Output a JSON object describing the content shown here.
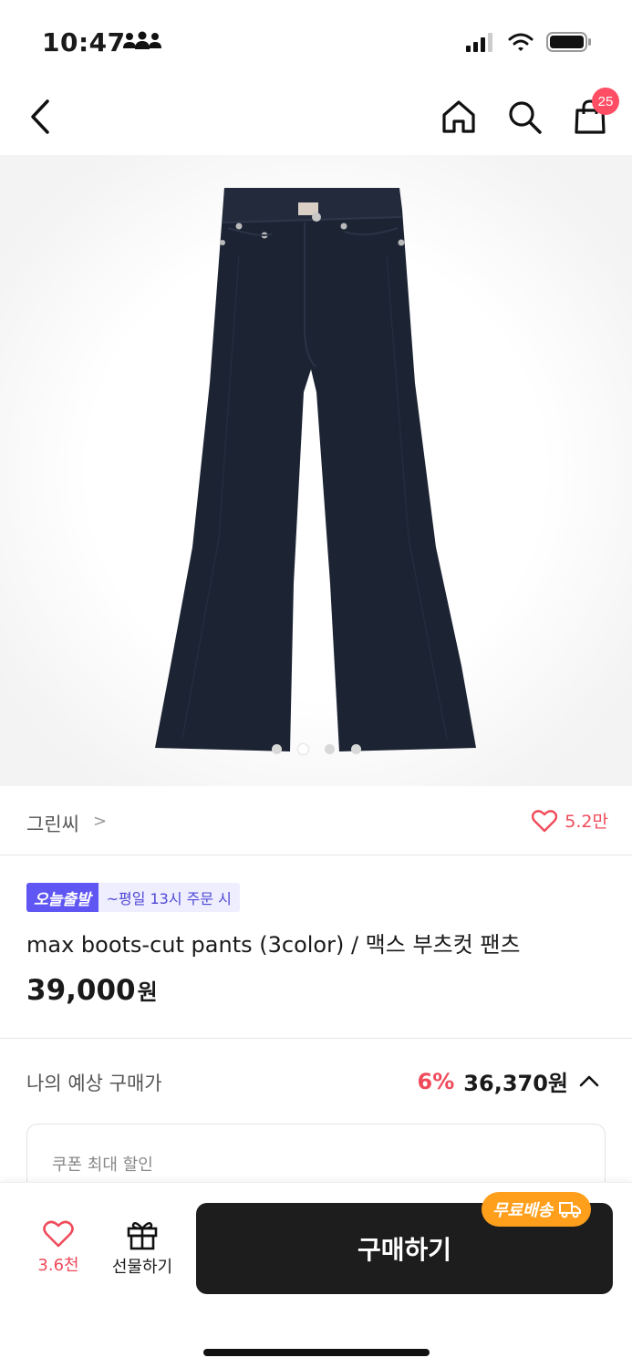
{
  "status": {
    "time": "10:47"
  },
  "nav": {
    "cart_count": "25"
  },
  "product": {
    "brand": "그린씨",
    "brand_chevron": ">",
    "likes": "5.2만",
    "tag_today": "오늘출발",
    "tag_desc": "~평일 13시 주문 시",
    "title": "max boots-cut pants (3color) / 맥스 부츠컷 팬츠",
    "price": "39,000",
    "price_unit": "원",
    "image_count": 4,
    "image_current": 2
  },
  "expected": {
    "label": "나의 예상 구매가",
    "discount": "6%",
    "price": "36,370원"
  },
  "coupon": {
    "label": "쿠폰 최대 할인"
  },
  "bottom": {
    "like_count": "3.6천",
    "gift_label": "선물하기",
    "buy_label": "구매하기",
    "free_ship": "무료배송"
  },
  "colors": {
    "accent_red": "#ef4b5b",
    "tag_purple": "#6056f3",
    "ship_orange": "#ff9f1c",
    "pants_navy": "#1c2333"
  },
  "icons": [
    "people-icon",
    "signal-icon",
    "wifi-icon",
    "battery-icon",
    "back-icon",
    "home-icon",
    "search-icon",
    "cart-icon",
    "heart-icon",
    "gift-icon",
    "truck-icon",
    "chevron-up-icon"
  ]
}
